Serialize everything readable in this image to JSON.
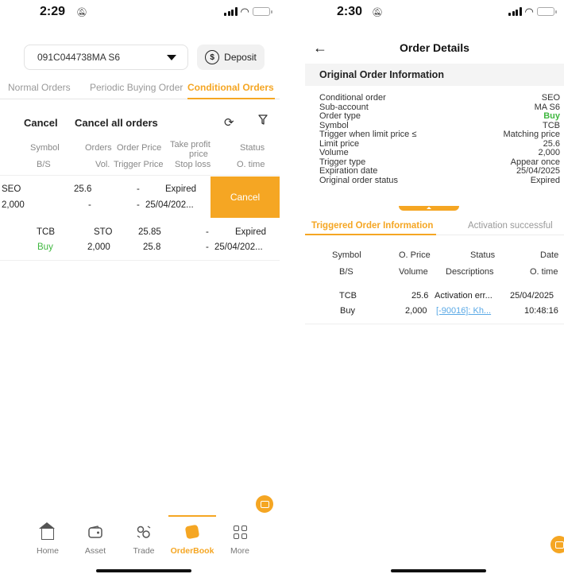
{
  "left_screen": {
    "status_time": "2:29",
    "account": {
      "value": "091C044738MA S6"
    },
    "deposit_label": "Deposit",
    "deposit_icon_glyph": "$",
    "tabs": [
      {
        "label": "Normal Orders"
      },
      {
        "label": "Periodic Buying Order"
      },
      {
        "label": "Conditional Orders"
      }
    ],
    "actions": {
      "cancel": "Cancel",
      "cancel_all": "Cancel all orders"
    },
    "columns": {
      "symbol": "Symbol",
      "bs": "B/S",
      "orders": "Orders",
      "vol": "Vol.",
      "order_price": "Order Price",
      "trigger_price": "Trigger Price",
      "take_profit_1": "Take profit",
      "take_profit_2": "price",
      "stop_loss": "Stop loss",
      "status": "Status",
      "o_time": "O. time"
    },
    "rows": [
      {
        "symbol": "SEO",
        "volume": "2,000",
        "orders": "",
        "order_price": "25.6",
        "trigger_price": "-",
        "take_profit": "-",
        "stop_loss": "-",
        "status": "Expired",
        "time": "25/04/202...",
        "swipe_action": "Cancel"
      },
      {
        "symbol": "TCB",
        "side": "Buy",
        "orders": "STO",
        "volume": "2,000",
        "order_price": "25.85",
        "trigger_price": "25.8",
        "take_profit": "-",
        "stop_loss": "-",
        "status": "Expired",
        "time": "25/04/202..."
      }
    ],
    "nav": [
      {
        "label": "Home",
        "icon": "home-icon"
      },
      {
        "label": "Asset",
        "icon": "wallet-icon"
      },
      {
        "label": "Trade",
        "icon": "trade-icon"
      },
      {
        "label": "OrderBook",
        "icon": "orderbook-icon",
        "active": true
      },
      {
        "label": "More",
        "icon": "grid-icon"
      }
    ]
  },
  "right_screen": {
    "status_time": "2:30",
    "title": "Order Details",
    "section_title": "Original Order Information",
    "info": [
      {
        "label": "Conditional order",
        "value": "SEO"
      },
      {
        "label": "Sub-account",
        "value": "MA S6"
      },
      {
        "label": "Order type",
        "value": "Buy"
      },
      {
        "label": "Symbol",
        "value": "TCB"
      },
      {
        "label": "Trigger when limit price ≤",
        "value": "Matching price"
      },
      {
        "label": "Limit price",
        "value": "25.6"
      },
      {
        "label": "Volume",
        "value": "2,000"
      },
      {
        "label": "Trigger type",
        "value": "Appear once"
      },
      {
        "label": "Expiration date",
        "value": "25/04/2025"
      },
      {
        "label": "Original order status",
        "value": "Expired"
      }
    ],
    "sub_tabs": [
      {
        "label": "Triggered Order Information"
      },
      {
        "label": "Activation successful"
      }
    ],
    "columns": {
      "symbol": "Symbol",
      "bs": "B/S",
      "o_price": "O. Price",
      "volume": "Volume",
      "status": "Status",
      "descriptions": "Descriptions",
      "date": "Date",
      "o_time": "O. time"
    },
    "row": {
      "symbol": "TCB",
      "side": "Buy",
      "o_price": "25.6",
      "volume": "2,000",
      "status": "Activation err...",
      "description": "[-90016]: Kh...",
      "date": "25/04/2025",
      "time": "10:48:16"
    }
  },
  "colors": {
    "accent": "#f5a623",
    "buy": "#3fb73f",
    "link": "#5aa9e6"
  }
}
